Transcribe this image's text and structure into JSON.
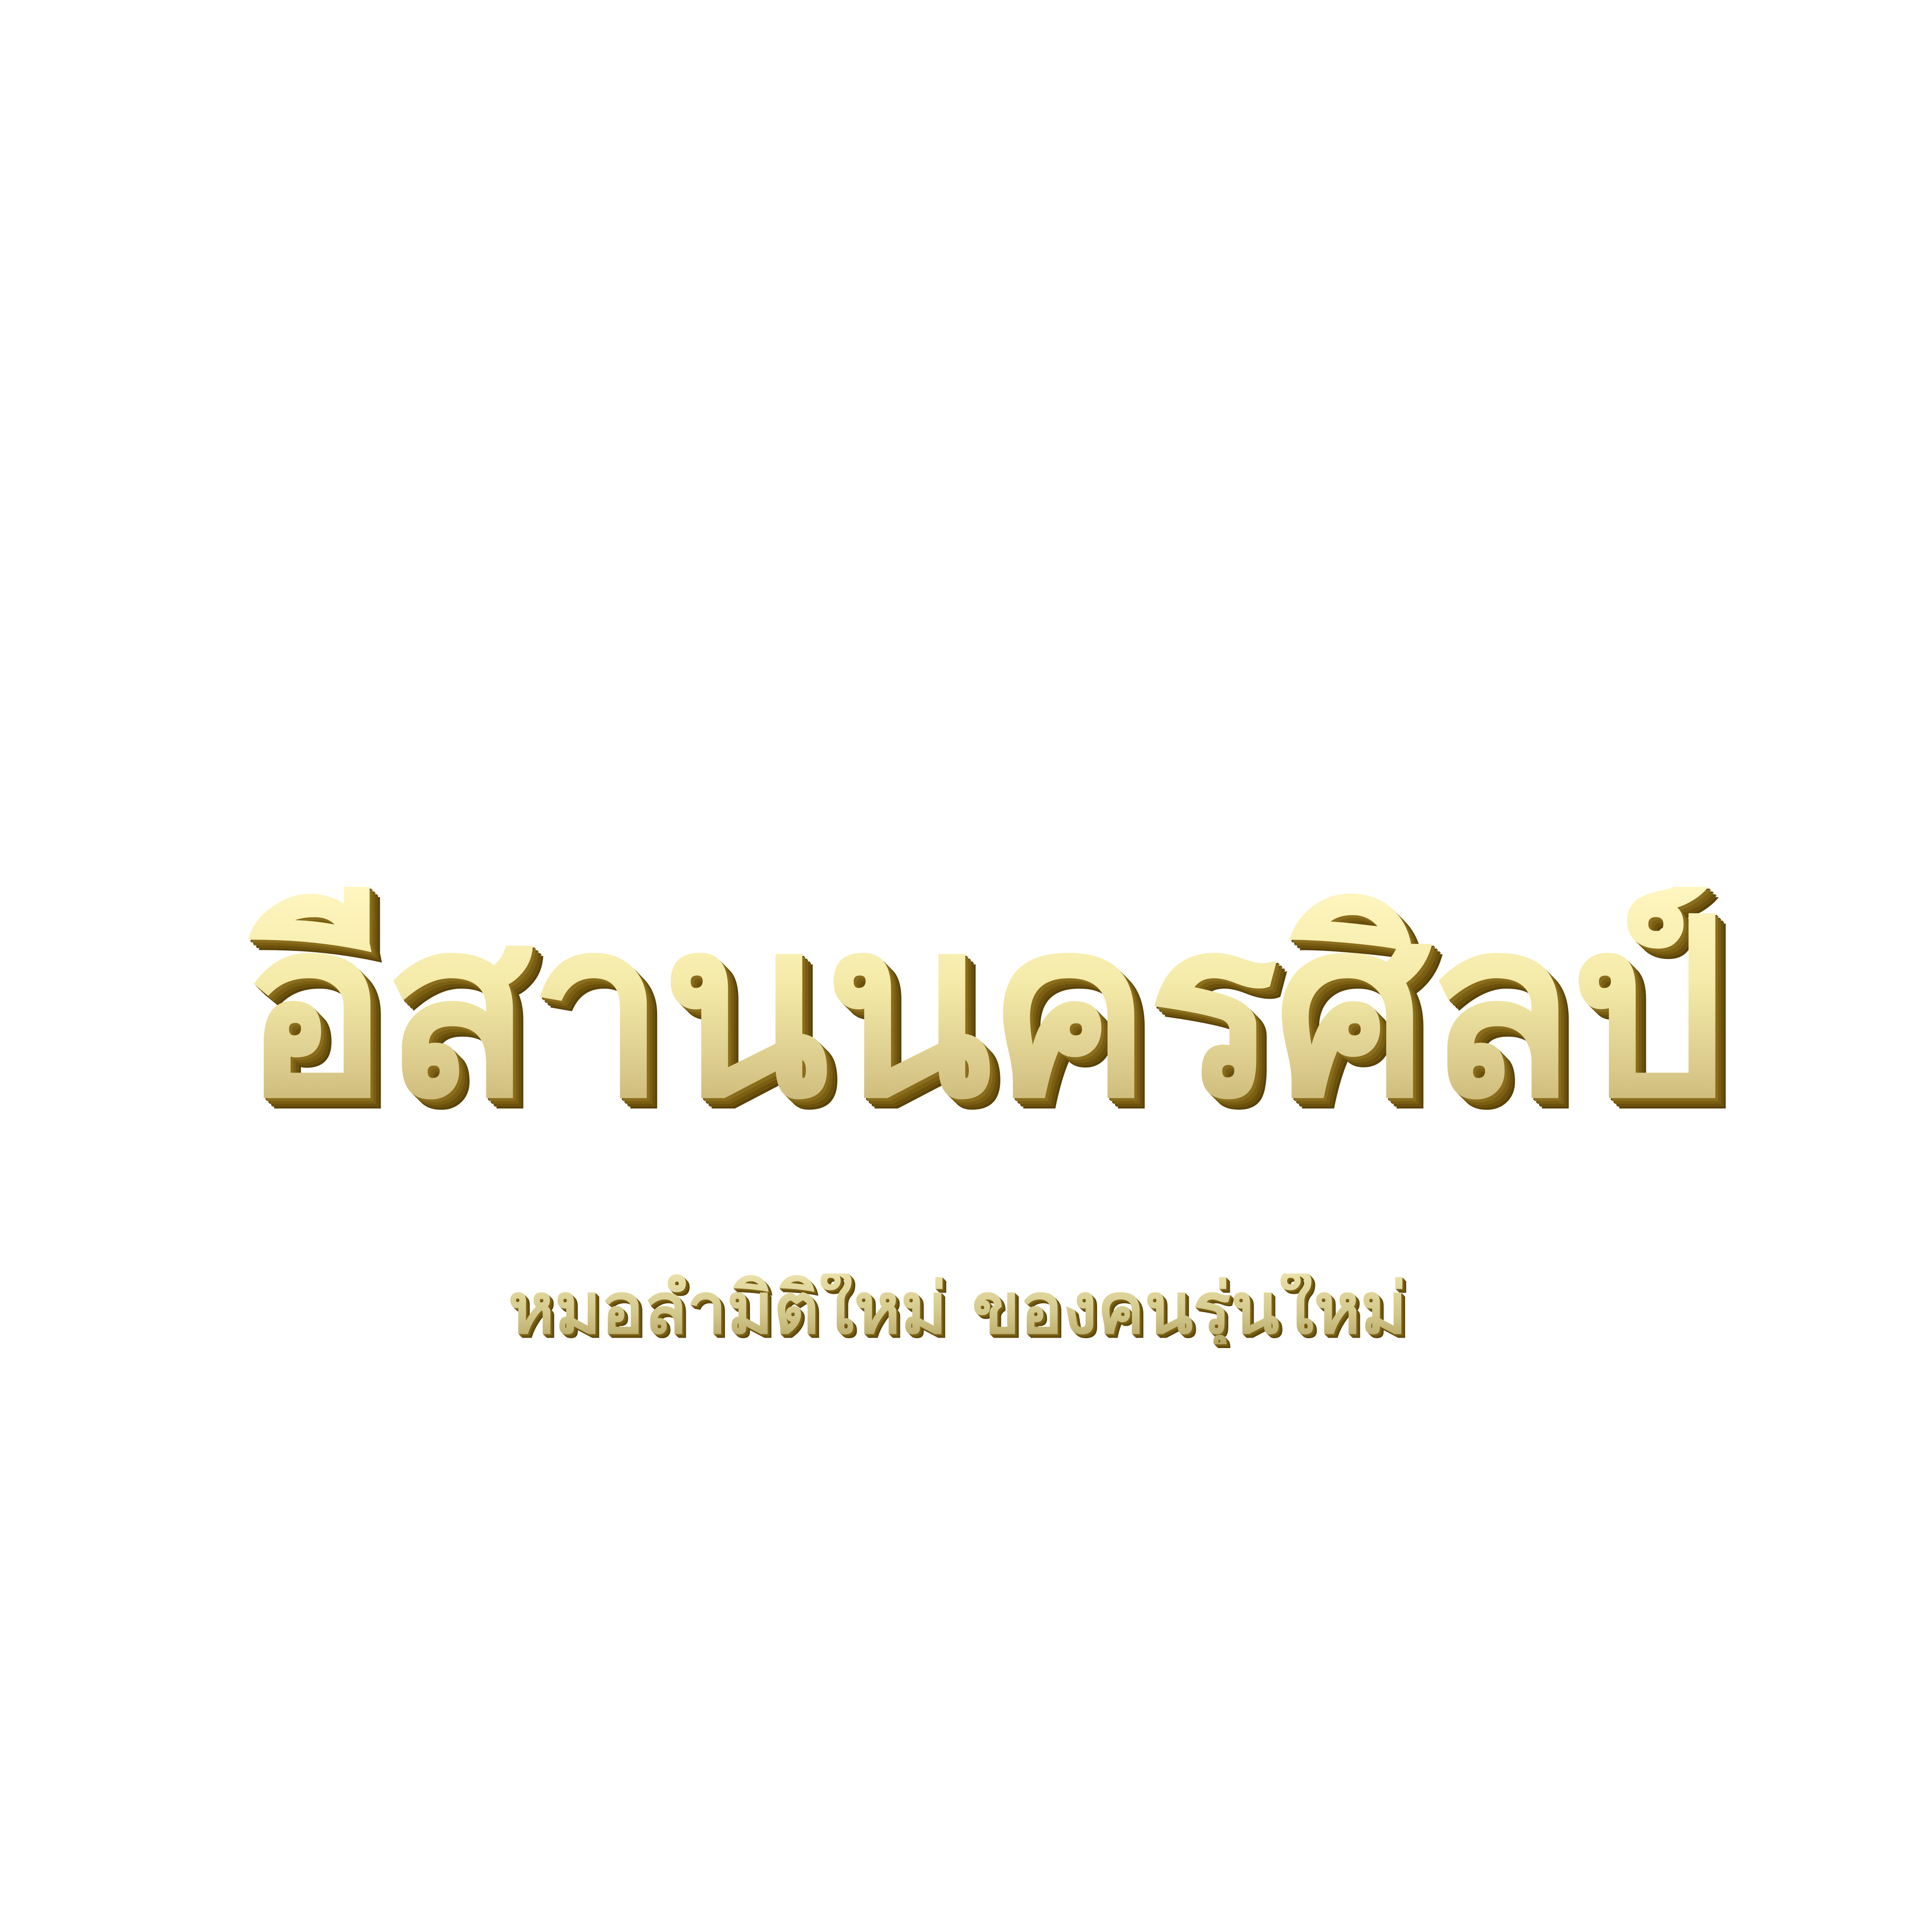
{
  "logo": {
    "title": "อีสานนครศิลป์",
    "subtitle": "หมอลำมิติใหม่ ของคนรุ่นใหม่",
    "colors": {
      "background": "#ffffff",
      "gold_light": "#fff6c0",
      "gold_mid": "#d9c98a",
      "gold_shadow": "#7a5e12"
    }
  }
}
